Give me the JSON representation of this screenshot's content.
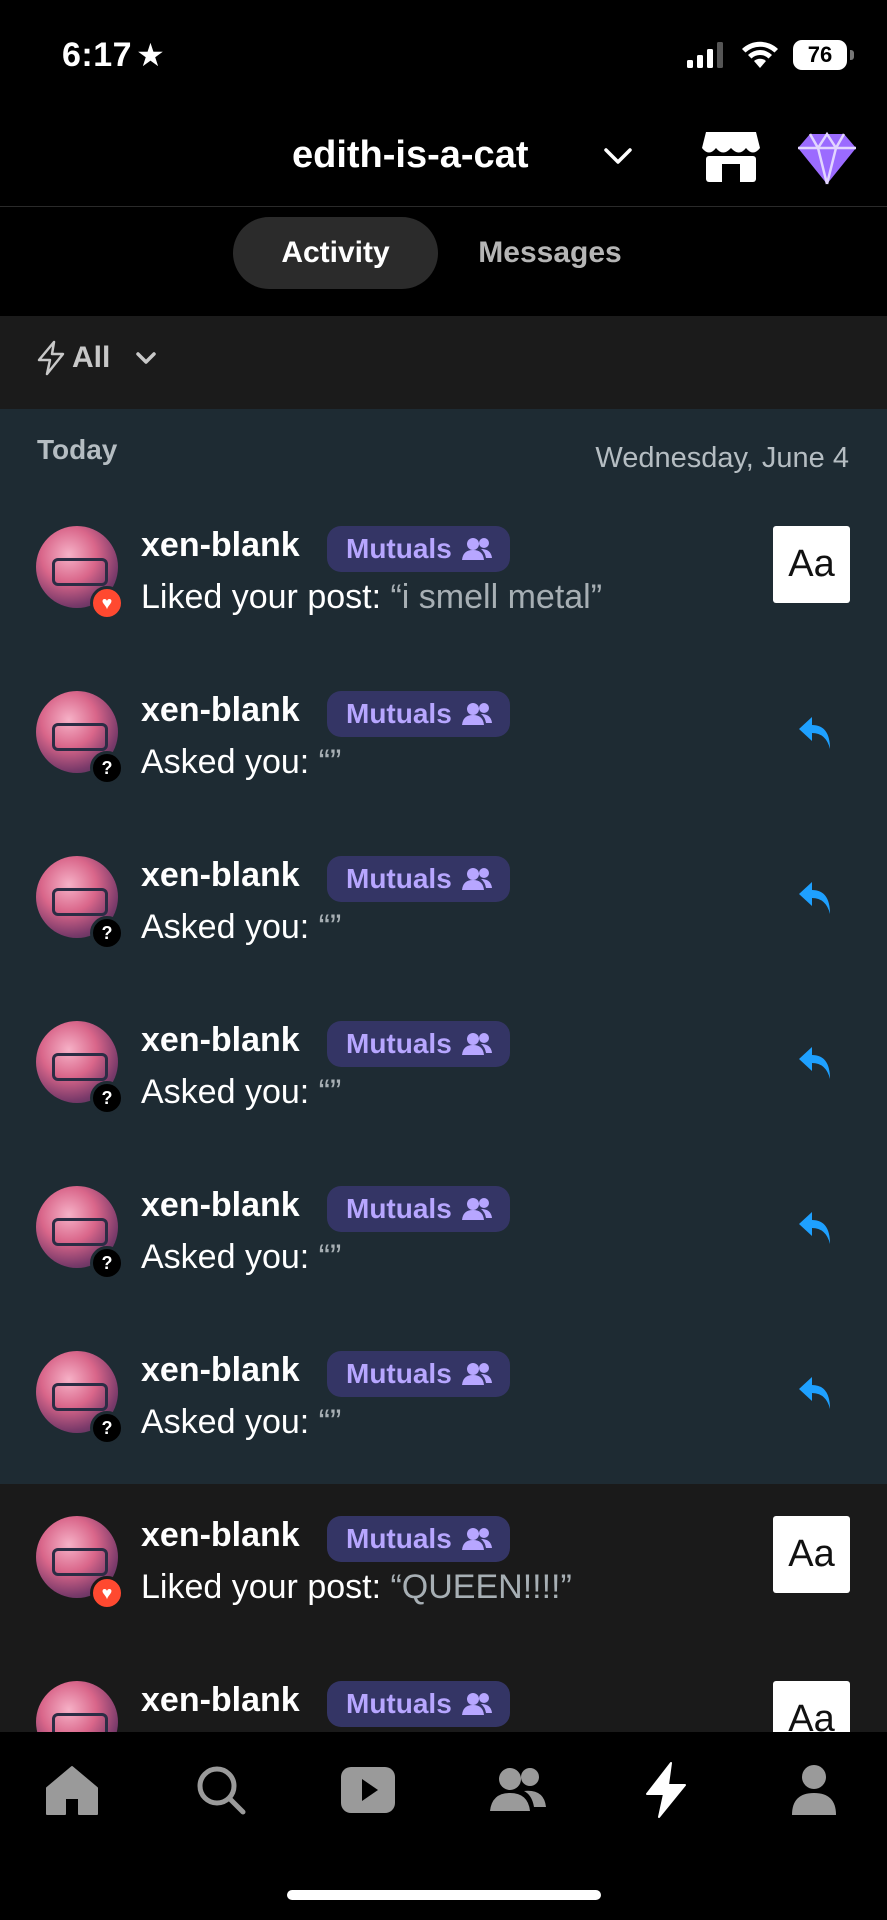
{
  "status": {
    "time": "6:17",
    "battery": "76"
  },
  "header": {
    "blog_name": "edith-is-a-cat"
  },
  "tabs": [
    {
      "label": "Activity",
      "selected": true
    },
    {
      "label": "Messages",
      "selected": false
    }
  ],
  "filter": {
    "label": "All"
  },
  "section": {
    "today": "Today",
    "date": "Wednesday, June 4"
  },
  "notifications": [
    {
      "user": "xen-blank",
      "tag": "Mutuals",
      "action": "Liked your post: ",
      "quote": "“i smell metal”",
      "type": "like",
      "thumb": "Aa"
    },
    {
      "user": "xen-blank",
      "tag": "Mutuals",
      "action": "Asked you: ",
      "quote": "“”",
      "type": "ask"
    },
    {
      "user": "xen-blank",
      "tag": "Mutuals",
      "action": "Asked you: ",
      "quote": "“”",
      "type": "ask"
    },
    {
      "user": "xen-blank",
      "tag": "Mutuals",
      "action": "Asked you: ",
      "quote": "“”",
      "type": "ask"
    },
    {
      "user": "xen-blank",
      "tag": "Mutuals",
      "action": "Asked you: ",
      "quote": "“”",
      "type": "ask"
    },
    {
      "user": "xen-blank",
      "tag": "Mutuals",
      "action": "Asked you: ",
      "quote": "“”",
      "type": "ask"
    },
    {
      "user": "xen-blank",
      "tag": "Mutuals",
      "action": "Liked your post: ",
      "quote": "“QUEEN!!!!”",
      "type": "like",
      "thumb": "Aa"
    },
    {
      "user": "xen-blank",
      "tag": "Mutuals",
      "thumb": "Aa"
    }
  ],
  "badges": {
    "like": "♥",
    "ask": "?"
  },
  "colors": {
    "accent": "#b7a6ff",
    "reply": "#1ea0ff",
    "like": "#ff4930",
    "panel": "#1e2b33"
  },
  "nav": [
    "home-icon",
    "search-icon",
    "video-icon",
    "community-icon",
    "activity-icon",
    "account-icon"
  ]
}
